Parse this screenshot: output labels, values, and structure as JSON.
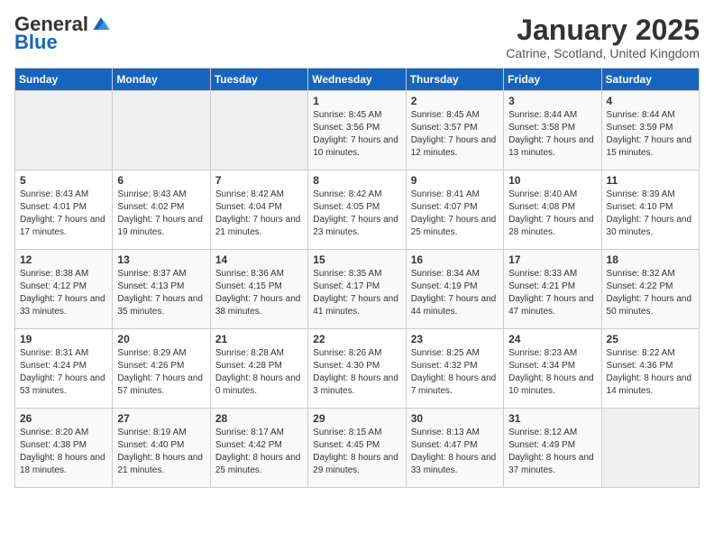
{
  "logo": {
    "general": "General",
    "blue": "Blue"
  },
  "title": "January 2025",
  "location": "Catrine, Scotland, United Kingdom",
  "weekdays": [
    "Sunday",
    "Monday",
    "Tuesday",
    "Wednesday",
    "Thursday",
    "Friday",
    "Saturday"
  ],
  "weeks": [
    [
      {
        "day": "",
        "sunrise": "",
        "sunset": "",
        "daylight": ""
      },
      {
        "day": "",
        "sunrise": "",
        "sunset": "",
        "daylight": ""
      },
      {
        "day": "",
        "sunrise": "",
        "sunset": "",
        "daylight": ""
      },
      {
        "day": "1",
        "sunrise": "Sunrise: 8:45 AM",
        "sunset": "Sunset: 3:56 PM",
        "daylight": "Daylight: 7 hours and 10 minutes."
      },
      {
        "day": "2",
        "sunrise": "Sunrise: 8:45 AM",
        "sunset": "Sunset: 3:57 PM",
        "daylight": "Daylight: 7 hours and 12 minutes."
      },
      {
        "day": "3",
        "sunrise": "Sunrise: 8:44 AM",
        "sunset": "Sunset: 3:58 PM",
        "daylight": "Daylight: 7 hours and 13 minutes."
      },
      {
        "day": "4",
        "sunrise": "Sunrise: 8:44 AM",
        "sunset": "Sunset: 3:59 PM",
        "daylight": "Daylight: 7 hours and 15 minutes."
      }
    ],
    [
      {
        "day": "5",
        "sunrise": "Sunrise: 8:43 AM",
        "sunset": "Sunset: 4:01 PM",
        "daylight": "Daylight: 7 hours and 17 minutes."
      },
      {
        "day": "6",
        "sunrise": "Sunrise: 8:43 AM",
        "sunset": "Sunset: 4:02 PM",
        "daylight": "Daylight: 7 hours and 19 minutes."
      },
      {
        "day": "7",
        "sunrise": "Sunrise: 8:42 AM",
        "sunset": "Sunset: 4:04 PM",
        "daylight": "Daylight: 7 hours and 21 minutes."
      },
      {
        "day": "8",
        "sunrise": "Sunrise: 8:42 AM",
        "sunset": "Sunset: 4:05 PM",
        "daylight": "Daylight: 7 hours and 23 minutes."
      },
      {
        "day": "9",
        "sunrise": "Sunrise: 8:41 AM",
        "sunset": "Sunset: 4:07 PM",
        "daylight": "Daylight: 7 hours and 25 minutes."
      },
      {
        "day": "10",
        "sunrise": "Sunrise: 8:40 AM",
        "sunset": "Sunset: 4:08 PM",
        "daylight": "Daylight: 7 hours and 28 minutes."
      },
      {
        "day": "11",
        "sunrise": "Sunrise: 8:39 AM",
        "sunset": "Sunset: 4:10 PM",
        "daylight": "Daylight: 7 hours and 30 minutes."
      }
    ],
    [
      {
        "day": "12",
        "sunrise": "Sunrise: 8:38 AM",
        "sunset": "Sunset: 4:12 PM",
        "daylight": "Daylight: 7 hours and 33 minutes."
      },
      {
        "day": "13",
        "sunrise": "Sunrise: 8:37 AM",
        "sunset": "Sunset: 4:13 PM",
        "daylight": "Daylight: 7 hours and 35 minutes."
      },
      {
        "day": "14",
        "sunrise": "Sunrise: 8:36 AM",
        "sunset": "Sunset: 4:15 PM",
        "daylight": "Daylight: 7 hours and 38 minutes."
      },
      {
        "day": "15",
        "sunrise": "Sunrise: 8:35 AM",
        "sunset": "Sunset: 4:17 PM",
        "daylight": "Daylight: 7 hours and 41 minutes."
      },
      {
        "day": "16",
        "sunrise": "Sunrise: 8:34 AM",
        "sunset": "Sunset: 4:19 PM",
        "daylight": "Daylight: 7 hours and 44 minutes."
      },
      {
        "day": "17",
        "sunrise": "Sunrise: 8:33 AM",
        "sunset": "Sunset: 4:21 PM",
        "daylight": "Daylight: 7 hours and 47 minutes."
      },
      {
        "day": "18",
        "sunrise": "Sunrise: 8:32 AM",
        "sunset": "Sunset: 4:22 PM",
        "daylight": "Daylight: 7 hours and 50 minutes."
      }
    ],
    [
      {
        "day": "19",
        "sunrise": "Sunrise: 8:31 AM",
        "sunset": "Sunset: 4:24 PM",
        "daylight": "Daylight: 7 hours and 53 minutes."
      },
      {
        "day": "20",
        "sunrise": "Sunrise: 8:29 AM",
        "sunset": "Sunset: 4:26 PM",
        "daylight": "Daylight: 7 hours and 57 minutes."
      },
      {
        "day": "21",
        "sunrise": "Sunrise: 8:28 AM",
        "sunset": "Sunset: 4:28 PM",
        "daylight": "Daylight: 8 hours and 0 minutes."
      },
      {
        "day": "22",
        "sunrise": "Sunrise: 8:26 AM",
        "sunset": "Sunset: 4:30 PM",
        "daylight": "Daylight: 8 hours and 3 minutes."
      },
      {
        "day": "23",
        "sunrise": "Sunrise: 8:25 AM",
        "sunset": "Sunset: 4:32 PM",
        "daylight": "Daylight: 8 hours and 7 minutes."
      },
      {
        "day": "24",
        "sunrise": "Sunrise: 8:23 AM",
        "sunset": "Sunset: 4:34 PM",
        "daylight": "Daylight: 8 hours and 10 minutes."
      },
      {
        "day": "25",
        "sunrise": "Sunrise: 8:22 AM",
        "sunset": "Sunset: 4:36 PM",
        "daylight": "Daylight: 8 hours and 14 minutes."
      }
    ],
    [
      {
        "day": "26",
        "sunrise": "Sunrise: 8:20 AM",
        "sunset": "Sunset: 4:38 PM",
        "daylight": "Daylight: 8 hours and 18 minutes."
      },
      {
        "day": "27",
        "sunrise": "Sunrise: 8:19 AM",
        "sunset": "Sunset: 4:40 PM",
        "daylight": "Daylight: 8 hours and 21 minutes."
      },
      {
        "day": "28",
        "sunrise": "Sunrise: 8:17 AM",
        "sunset": "Sunset: 4:42 PM",
        "daylight": "Daylight: 8 hours and 25 minutes."
      },
      {
        "day": "29",
        "sunrise": "Sunrise: 8:15 AM",
        "sunset": "Sunset: 4:45 PM",
        "daylight": "Daylight: 8 hours and 29 minutes."
      },
      {
        "day": "30",
        "sunrise": "Sunrise: 8:13 AM",
        "sunset": "Sunset: 4:47 PM",
        "daylight": "Daylight: 8 hours and 33 minutes."
      },
      {
        "day": "31",
        "sunrise": "Sunrise: 8:12 AM",
        "sunset": "Sunset: 4:49 PM",
        "daylight": "Daylight: 8 hours and 37 minutes."
      },
      {
        "day": "",
        "sunrise": "",
        "sunset": "",
        "daylight": ""
      }
    ]
  ]
}
